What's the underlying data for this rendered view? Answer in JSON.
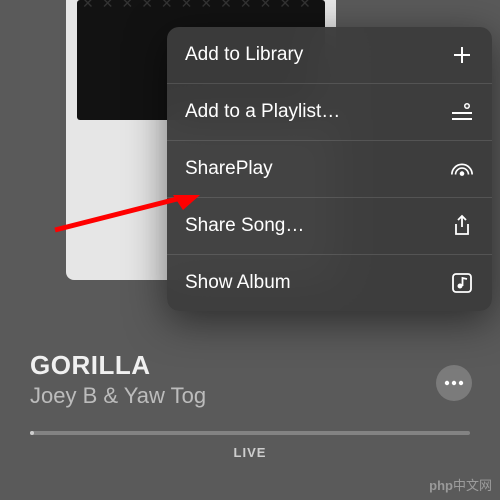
{
  "menu": {
    "items": [
      {
        "label": "Add to Library",
        "icon": "plus-icon"
      },
      {
        "label": "Add to a Playlist…",
        "icon": "playlist-add-icon"
      },
      {
        "label": "SharePlay",
        "icon": "shareplay-icon"
      },
      {
        "label": "Share Song…",
        "icon": "share-icon"
      },
      {
        "label": "Show Album",
        "icon": "album-icon"
      }
    ]
  },
  "track": {
    "title": "GORILLA",
    "artist": "Joey B & Yaw Tog"
  },
  "playback": {
    "status": "LIVE"
  },
  "watermark": {
    "brand": "php",
    "suffix": "中文网"
  }
}
